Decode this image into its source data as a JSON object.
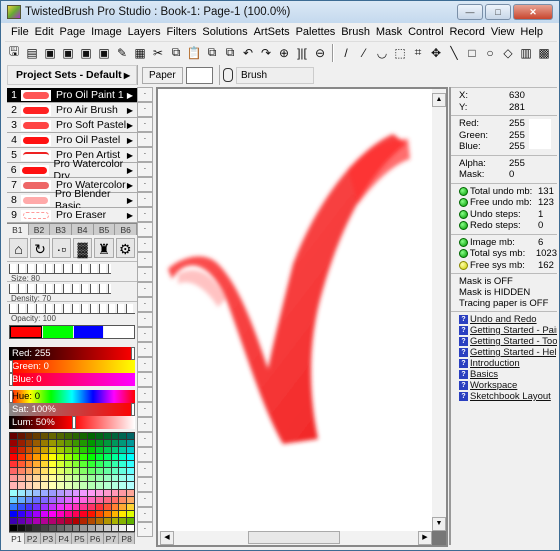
{
  "window": {
    "title": "TwistedBrush Pro Studio : Book-1: Page-1 (100.0%)"
  },
  "menu": [
    "File",
    "Edit",
    "Page",
    "Image",
    "Layers",
    "Filters",
    "Solutions",
    "ArtSets",
    "Palettes",
    "Brush",
    "Mask",
    "Control",
    "Record",
    "View",
    "Help"
  ],
  "header": {
    "project_sets": "Project Sets - Default",
    "paper_label": "Paper",
    "brush_label": "Brush"
  },
  "brushes": [
    {
      "n": "1",
      "name": "Pro Oil Paint 1",
      "selected": true
    },
    {
      "n": "2",
      "name": "Pro Air Brush"
    },
    {
      "n": "3",
      "name": "Pro Soft Pastel"
    },
    {
      "n": "4",
      "name": "Pro Oil Pastel"
    },
    {
      "n": "5",
      "name": "Pro Pen Artist"
    },
    {
      "n": "6",
      "name": "Pro Watercolor Dry"
    },
    {
      "n": "7",
      "name": "Pro Watercolor"
    },
    {
      "n": "8",
      "name": "Pro Blender Basic"
    },
    {
      "n": "9",
      "name": "Pro Eraser"
    }
  ],
  "brush_tabs": [
    "B1",
    "B2",
    "B3",
    "B4",
    "B5",
    "B6"
  ],
  "sliders": {
    "size": "Size: 80",
    "density": "Density: 70",
    "opacity": "Opacity: 100",
    "size_value": 80,
    "density_value": 70,
    "opacity_value": 100
  },
  "colors": {
    "red": "Red: 255",
    "green": "Green: 0",
    "blue": "Blue: 0",
    "hue": "Hue: 0",
    "sat": "Sat: 100%",
    "lum": "Lum: 50%",
    "current": "#ff0000"
  },
  "palette_tabs": [
    "P1",
    "P2",
    "P3",
    "P4",
    "P5",
    "P6",
    "P7",
    "P8"
  ],
  "info": {
    "coords": [
      [
        "X:",
        "630"
      ],
      [
        "Y:",
        "281"
      ]
    ],
    "rgb": [
      [
        "Red:",
        "255"
      ],
      [
        "Green:",
        "255"
      ],
      [
        "Blue:",
        "255"
      ]
    ],
    "alpha": [
      [
        "Alpha:",
        "255"
      ],
      [
        "Mask:",
        "0"
      ]
    ],
    "undo": [
      [
        "Total undo mb:",
        "131"
      ],
      [
        "Free undo mb:",
        "123"
      ],
      [
        "Undo steps:",
        "1"
      ],
      [
        "Redo steps:",
        "0"
      ]
    ],
    "mem": [
      [
        "Image mb:",
        "6"
      ],
      [
        "Total sys mb:",
        "1023"
      ],
      [
        "Free sys mb:",
        "162"
      ]
    ],
    "status": [
      "Mask is OFF",
      "Mask is HIDDEN",
      "Tracing paper is OFF"
    ],
    "help_links": [
      "Undo and Redo",
      "Getting Started - Painting",
      "Getting Started - Tools",
      "Getting Started - Help",
      "Introduction",
      "Basics",
      "Workspace",
      "Sketchbook Layout"
    ]
  }
}
